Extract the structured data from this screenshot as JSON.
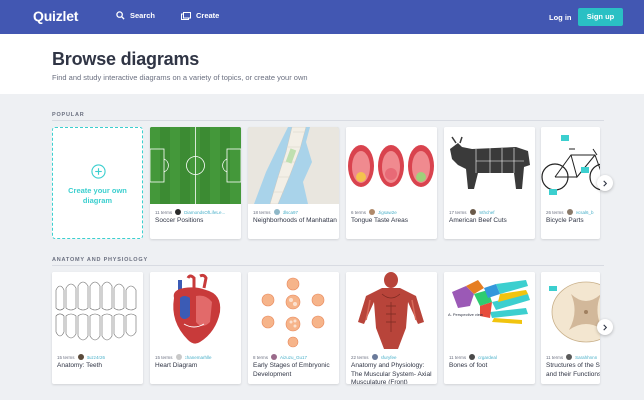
{
  "nav": {
    "logo": "Quizlet",
    "search_label": "Search",
    "create_label": "Create",
    "login_label": "Log in",
    "signup_label": "Sign up"
  },
  "hero": {
    "title": "Browse diagrams",
    "subtitle": "Find and study interactive diagrams on a variety of topics, or create your own"
  },
  "popular": {
    "label": "POPULAR",
    "create_card_label": "Create your own diagram",
    "cards": [
      {
        "terms": "11 terms",
        "user": "DiamondsOfLifeLe...",
        "title": "Soccer Positions"
      },
      {
        "terms": "18 terms",
        "user": "dlsca97",
        "title": "Neighborhoods of Manhattan"
      },
      {
        "terms": "6 terms",
        "user": "Jigsaw2e",
        "title": "Tongue Taste Areas"
      },
      {
        "terms": "17 terms",
        "user": "mthchef",
        "title": "American Beef Cuts"
      },
      {
        "terms": "26 terms",
        "user": "ecsal6_b",
        "title": "Bicycle Parts"
      }
    ]
  },
  "anatomy": {
    "label": "ANATOMY AND PHYSIOLOGY",
    "cards": [
      {
        "terms": "15 terms",
        "user": "ttuzz4r26",
        "title": "Anatomy: Teeth"
      },
      {
        "terms": "15 terms",
        "user": "chanemarhlle",
        "title": "Heart Diagram"
      },
      {
        "terms": "8 terms",
        "user": "Aizuzu_Gu17",
        "title": "Early Stages of Embryonic Development"
      },
      {
        "terms": "22 terms",
        "user": "sfuryfee",
        "title": "Anatomy and Physiology: The Muscular System- Axial Musculature (Front)"
      },
      {
        "terms": "11 terms",
        "user": "crgardeal",
        "title": "Bones of foot"
      },
      {
        "terms": "11 terms",
        "user": "Sarahhnnn",
        "title": "Structures of the Spinal Cord and their Functions"
      }
    ]
  },
  "thumb_notes": {
    "foot_caption": "A. Perspective view"
  },
  "colors": {
    "brand": "#4257b2",
    "accent": "#3ccfcf",
    "signup": "#2ac0c4"
  }
}
